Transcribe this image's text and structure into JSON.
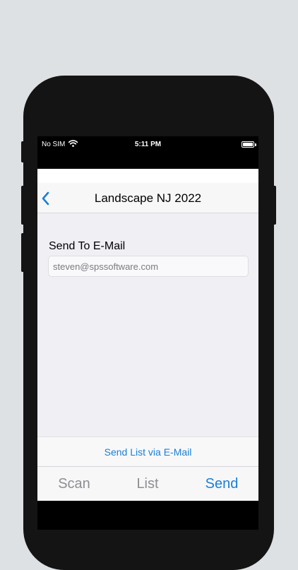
{
  "status_bar": {
    "carrier": "No SIM",
    "wifi_icon": "wifi-icon",
    "time": "5:11 PM",
    "battery_icon": "battery-full-icon"
  },
  "nav": {
    "back_icon": "chevron-left-icon",
    "title": "Landscape NJ 2022"
  },
  "form": {
    "label": "Send To E-Mail",
    "email_placeholder": "steven@spssoftware.com"
  },
  "action": {
    "send_label": "Send List via E-Mail"
  },
  "tabs": [
    {
      "label": "Scan",
      "selected": false
    },
    {
      "label": "List",
      "selected": false
    },
    {
      "label": "Send",
      "selected": true
    }
  ],
  "colors": {
    "accent": "#1a7fd6",
    "inactive_tab": "#8e8e93",
    "background": "#efeff4"
  }
}
